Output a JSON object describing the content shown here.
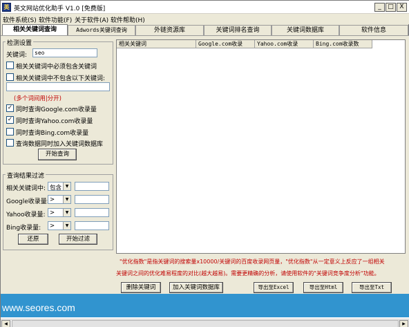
{
  "window": {
    "title": "英文网站优化助手 V1.0 [免费版]",
    "icon_label": "英",
    "controls": {
      "minimize": "_",
      "maximize": "□",
      "close": "X"
    }
  },
  "menu": [
    {
      "label": "软件系统(S)"
    },
    {
      "label": "软件功能(F)"
    },
    {
      "label": "关于软件(A)"
    },
    {
      "label": "软件帮助(H)"
    }
  ],
  "tabs": [
    {
      "label": "相关关键词查询"
    },
    {
      "label": "Adwords关键词查询"
    },
    {
      "label": "外链资源库"
    },
    {
      "label": "关键词排名查询"
    },
    {
      "label": "关键词数据库"
    },
    {
      "label": "软件信息"
    }
  ],
  "detect_settings": {
    "title": "检测设置",
    "keyword_label": "关键词:",
    "keyword_value": "seo",
    "must_include_label": "相关关键词中必须包含关键词",
    "exclude_label": "相关关键词中不包含以下关键词:",
    "exclude_value": "",
    "separator_hint": "(多个词间用|分开)",
    "query_google_label": "同时查询Google.com收录量",
    "query_yahoo_label": "同时查询Yahoo.com收录量",
    "query_bing_label": "同时查询Bing.com收录量",
    "add_to_db_label": "查询数据同时加入关键词数据库",
    "start_button": "开始查询",
    "must_include_checked": false,
    "query_google_checked": true,
    "query_yahoo_checked": true,
    "query_bing_checked": false,
    "add_to_db_checked": false,
    "check_mark": "✓"
  },
  "filter": {
    "title": "查询结果过滤",
    "related_label": "相关关键词中:",
    "related_op": "包含",
    "related_value": "",
    "google_label": "Google收录量:",
    "google_op": ">",
    "google_value": "",
    "yahoo_label": "Yahoo收录量:",
    "yahoo_op": ">",
    "yahoo_value": "",
    "bing_label": "Bing收录量:",
    "bing_op": ">",
    "bing_value": "",
    "reset_button": "还原",
    "start_filter_button": "开始过滤",
    "dropdown_arrow": "▼"
  },
  "results_table": {
    "columns": [
      {
        "label": "相关关键词"
      },
      {
        "label": "Google.com收录"
      },
      {
        "label": "Yahoo.com收录"
      },
      {
        "label": "Bing.com收录数"
      }
    ],
    "rows": []
  },
  "info_text": {
    "line1": "\"优化指数\"是指关键词的搜索量x10000/关键词的百度收录网页量，\"优化指数\"从一定意义上反应了一组相关",
    "line2": "关键词之间的优化难易程度的对比(越大越易)。需要更精确的分析，请使用软件的\"关键词竞争度分析\"功能。"
  },
  "bottom_buttons": {
    "delete": "删除关键词",
    "add_db": "加入关键词数据库",
    "export_excel": "导出至Excel",
    "export_html": "导出至Html",
    "export_txt": "导出至Txt"
  },
  "banner": {
    "url": "www.seores.com"
  },
  "scrollbar": {
    "left_arrow": "◀",
    "right_arrow": "▶"
  }
}
